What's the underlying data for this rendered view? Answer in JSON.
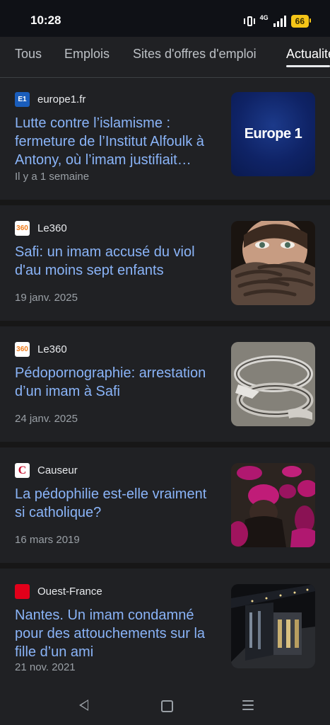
{
  "status": {
    "time": "10:28",
    "network": "4G",
    "battery": "66"
  },
  "tabs": [
    {
      "label": "Tous"
    },
    {
      "label": "Emplois"
    },
    {
      "label": "Sites d'offres d'emploi"
    },
    {
      "label": "Actualités"
    }
  ],
  "articles": [
    {
      "source": "europe1.fr",
      "favicon_text": "E1",
      "title": "Lutte contre l’islamisme : fermeture de l’Institut Alfoulk à Antony, où l’imam justifiait…",
      "date": "Il y a 1 semaine",
      "thumb_text": "Europe 1"
    },
    {
      "source": "Le360",
      "favicon_text": "360",
      "title": "Safi: un imam accusé du viol d'au moins sept enfants",
      "date": "19 janv. 2025"
    },
    {
      "source": "Le360",
      "favicon_text": "360",
      "title": "Pédopornographie: arrestation d’un imam à Safi",
      "date": "24 janv. 2025"
    },
    {
      "source": "Causeur",
      "favicon_text": "C",
      "title": "La pédophilie est-elle vraiment si catholique?",
      "date": "16 mars 2019"
    },
    {
      "source": "Ouest-France",
      "favicon_text": "",
      "title": "Nantes. Un imam condamné pour des attouchements sur la fille d’un ami",
      "date": "21 nov. 2021"
    }
  ],
  "colors": {
    "background": "#202124",
    "link": "#8ab4f8",
    "meta": "#9aa0a6"
  },
  "icons": {
    "back": "back-icon",
    "home": "home-icon",
    "recents": "recents-icon"
  }
}
